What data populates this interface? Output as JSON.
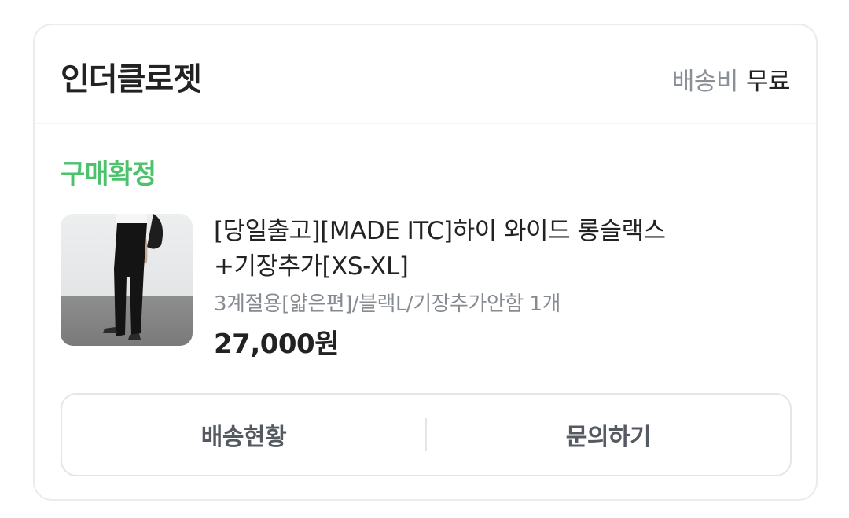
{
  "order": {
    "store_name": "인더클로젯",
    "shipping_label": "배송비",
    "shipping_value": "무료",
    "status": "구매확정",
    "status_color": "#4cc26c"
  },
  "product": {
    "title_line1": "[당일출고][MADE ITC]하이 와이드 롱슬랙스",
    "title_line2": "+기장추가[XS-XL]",
    "option": "3계절용[얇은편]/블랙L/기장추가안함 1개",
    "price": "27,000원",
    "image_icon": "product-thumbnail"
  },
  "actions": {
    "delivery_status_label": "배송현황",
    "inquiry_label": "문의하기"
  }
}
